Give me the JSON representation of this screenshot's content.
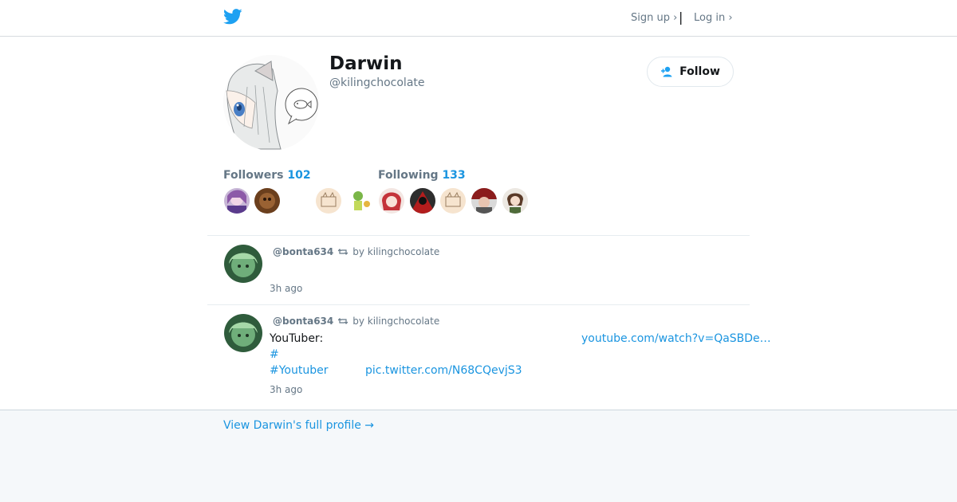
{
  "header": {
    "signup_label": "Sign up ›",
    "separator": "|",
    "login_label": "Log in ›",
    "logo_icon": "twitter-bird-icon",
    "brand_color": "#1da1f2"
  },
  "profile": {
    "display_name": "Darwin",
    "handle": "@kilingchocolate",
    "follow_label": "Follow",
    "follow_icon": "add-user-icon"
  },
  "stats": {
    "followers_label": "Followers",
    "followers_count": "102",
    "following_label": "Following",
    "following_count": "133"
  },
  "tweets": [
    {
      "user": "@bonta634",
      "retweet_by": "by kilingchocolate",
      "time": "3h ago",
      "text": ""
    },
    {
      "user": "@bonta634",
      "retweet_by": "by kilingchocolate",
      "text_prefix": "YouTuber:",
      "link_youtube": "youtube.com/watch?v=QaSBDe…",
      "hashtag_1": "#",
      "hashtag_2": "#Youtuber",
      "pic_link": "pic.twitter.com/N68CQevjS3",
      "time": "3h ago"
    }
  ],
  "footer": {
    "full_profile_link": "View Darwin's full profile →"
  },
  "colors": {
    "link": "#1b95e0",
    "muted": "#657786",
    "footer_bg": "#f5f8fa"
  }
}
